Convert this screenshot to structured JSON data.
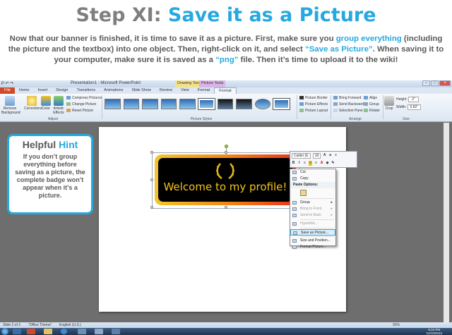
{
  "heading": {
    "prefix": "Step XI:",
    "highlight": "Save it as a Picture"
  },
  "intro": {
    "p1": "Now that our banner is finished, it is time to save it as a picture. First, make sure you ",
    "h1": "group everything",
    "p2": " (including the picture and the textbox) into one object. Then, right-click on it, and select ",
    "h2": "“Save as Picture”",
    "p3": ". When saving it to your computer, make sure it is saved as a ",
    "h3": "“png”",
    "p4": " file. Then it’s time to upload it to the wiki!"
  },
  "window": {
    "doc_title": "Presentation1 - Microsoft PowerPoint",
    "ctx_drawing": "Drawing Tools",
    "ctx_picture": "Picture Tools"
  },
  "tabs": [
    "File",
    "Home",
    "Insert",
    "Design",
    "Transitions",
    "Animations",
    "Slide Show",
    "Review",
    "View",
    "Format",
    "Format"
  ],
  "ribbon": {
    "remove_bg": "Remove Background",
    "corrections": "Corrections",
    "color": "Color",
    "artistic": "Artistic Effects",
    "compress": "Compress Pictures",
    "change": "Change Picture",
    "reset": "Reset Picture",
    "adjust_label": "Adjust",
    "styles_label": "Picture Styles",
    "border": "Picture Border",
    "effects": "Picture Effects",
    "layout": "Picture Layout",
    "bring": "Bring Forward",
    "send": "Send Backward",
    "selection": "Selection Pane",
    "align": "Align",
    "group": "Group",
    "rotate": "Rotate",
    "arrange_label": "Arrange",
    "crop": "Crop",
    "height_label": "Height:",
    "height_val": "2\"",
    "width_label": "Width:",
    "width_val": "5.82\"",
    "size_label": "Size"
  },
  "hint": {
    "title_prefix": "Helpful",
    "title_highlight": "Hint",
    "body": "If you don’t group everything before saving as a picture, the complete badge won’t appear when it’s a picture."
  },
  "badge": {
    "text": "Welcome to my profile!"
  },
  "mini_toolbar": {
    "font": "Calibri (E",
    "size": "18"
  },
  "context_menu": {
    "items": [
      "Cut",
      "Copy",
      "Paste Options:",
      "Group",
      "Bring to Front",
      "Send to Back",
      "Hyperlink...",
      "Save as Picture...",
      "Size and Position...",
      "Format Picture..."
    ]
  },
  "status": {
    "slide": "Slide 2 of 2",
    "theme": "\"Office Theme\"",
    "lang": "English (U.S.)",
    "zoom": "92%"
  },
  "clock": {
    "time": "8:10 PM",
    "date": "12/10/2013"
  },
  "colors": {
    "accent": "#26a9e0",
    "text_gray": "#595959",
    "file_tab": "#d14a25"
  }
}
